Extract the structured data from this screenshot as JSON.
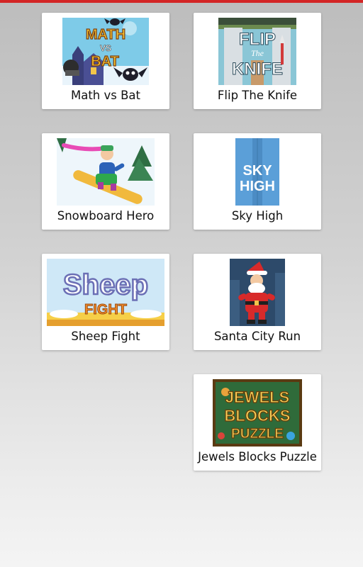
{
  "accent_color": "#d32626",
  "games": [
    {
      "title": "Math vs Bat",
      "thumbnail": "math-vs-bat-thumbnail"
    },
    {
      "title": "Flip The Knife",
      "thumbnail": "flip-the-knife-thumbnail"
    },
    {
      "title": "Snowboard Hero",
      "thumbnail": "snowboard-hero-thumbnail"
    },
    {
      "title": "Sky High",
      "thumbnail": "sky-high-thumbnail"
    },
    {
      "title": "Sheep Fight",
      "thumbnail": "sheep-fight-thumbnail"
    },
    {
      "title": "Santa City Run",
      "thumbnail": "santa-city-run-thumbnail"
    },
    {
      "title": "Jewels Blocks Puzzle",
      "thumbnail": "jewels-blocks-puzzle-thumbnail"
    }
  ]
}
